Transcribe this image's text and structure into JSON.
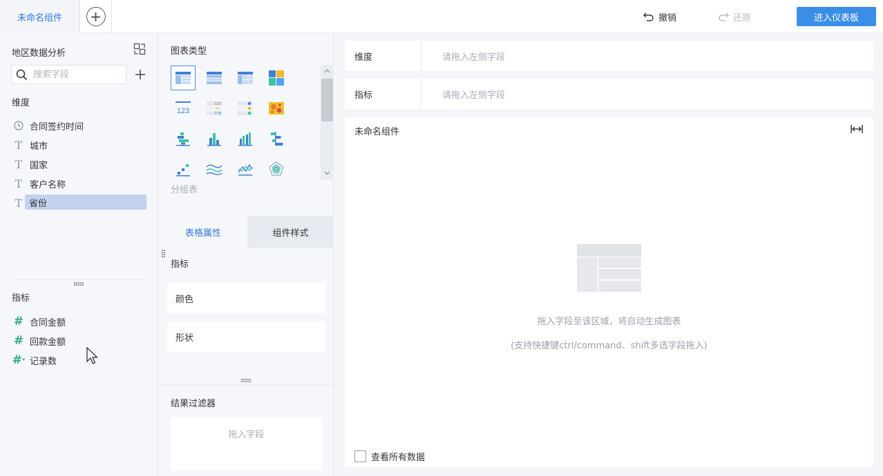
{
  "topbar": {
    "tab_name": "未命名组件",
    "undo_label": "撤销",
    "redo_label": "还原",
    "enter_dashboard_label": "进入仪表板"
  },
  "left": {
    "dataset_title": "地区数据分析",
    "search_placeholder": "搜索字段",
    "dimension_label": "维度",
    "dimensions": [
      {
        "label": "合同签约时间",
        "icon": "clock-icon"
      },
      {
        "label": "城市",
        "icon": "text-type-icon"
      },
      {
        "label": "国家",
        "icon": "text-type-icon"
      },
      {
        "label": "客户名称",
        "icon": "text-type-icon"
      },
      {
        "label": "省份",
        "icon": "text-type-icon",
        "selected": true
      }
    ],
    "measure_label": "指标",
    "measures": [
      {
        "label": "合同金额",
        "icon": "number-type-icon"
      },
      {
        "label": "回款金额",
        "icon": "number-type-icon"
      },
      {
        "label": "记录数",
        "icon": "record-count-icon"
      }
    ]
  },
  "middle": {
    "chart_type_title": "图表类型",
    "chart_type_name": "分组表",
    "chart_types": [
      "grouped-table-icon",
      "detail-table-icon",
      "cross-table-icon",
      "treemap-icon",
      "number-card-icon",
      "number-table-icon",
      "indicator-list-icon",
      "heatmap-icon",
      "stacked-bar-icon",
      "multi-bar-icon",
      "column-chart-icon",
      "horizontal-bar-icon",
      "scatter-icon",
      "line-icon",
      "area-line-icon",
      "radar-icon"
    ],
    "tab_table_props": "表格属性",
    "tab_component_style": "组件样式",
    "props_title": "指标",
    "prop_color": "颜色",
    "prop_shape": "形状",
    "filter_title": "结果过滤器",
    "filter_drop_hint": "拖入字段"
  },
  "right": {
    "dimension_row_label": "维度",
    "dimension_row_hint": "请拖入左侧字段",
    "measure_row_label": "指标",
    "measure_row_hint": "请拖入左侧字段",
    "canvas_title": "未命名组件",
    "empty_hint": "拖入字段至该区域，将自动生成图表",
    "empty_hint_sub": "(支持快捷键ctrl/command、shift多选字段拖入)",
    "view_all_label": "查看所有数据"
  },
  "colors": {
    "accent": "#3a8ee6",
    "selected_field_bg": "#c3d2ef",
    "number_field_icon": "#37a88a"
  }
}
